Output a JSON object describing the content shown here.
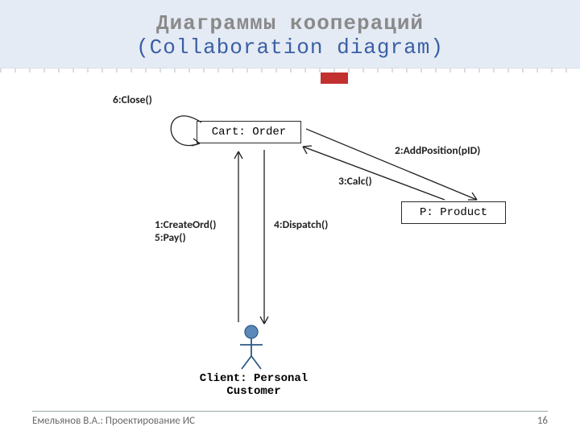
{
  "header": {
    "title_ru": "Диаграммы коопераций",
    "title_en": "(Collaboration diagram)"
  },
  "nodes": {
    "order": "Cart: Order",
    "product": "P: Product",
    "actor": "Client: Personal Customer"
  },
  "messages": {
    "m1": "1:CreateOrd()",
    "m5": "5:Pay()",
    "m4": "4:Dispatch()",
    "m2": "2:AddPosition(pID)",
    "m3": "3:Calc()",
    "m6": "6:Close()"
  },
  "footer": {
    "author": "Емельянов В.А.: Проектирование ИС",
    "page": "16"
  }
}
